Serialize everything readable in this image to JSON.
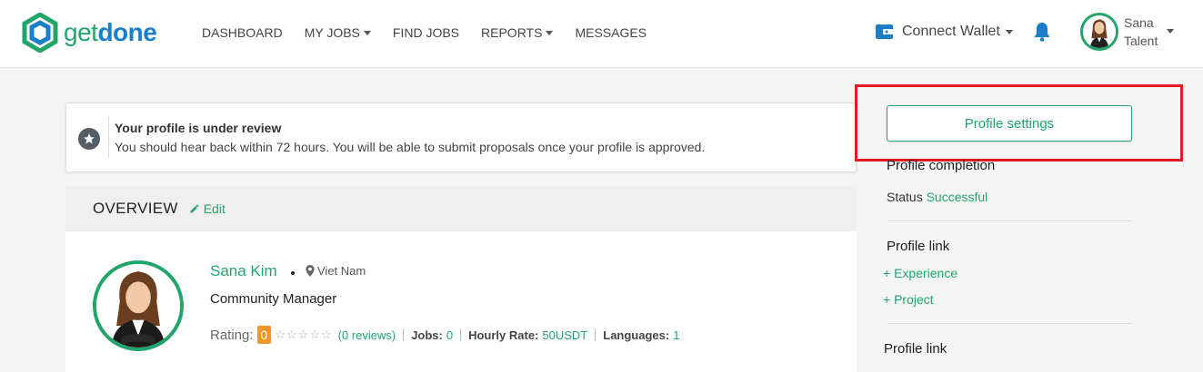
{
  "header": {
    "logo": {
      "part1": "get",
      "part2": "done"
    },
    "nav": [
      {
        "label": "DASHBOARD",
        "has_dropdown": false
      },
      {
        "label": "MY JOBS",
        "has_dropdown": true
      },
      {
        "label": "FIND JOBS",
        "has_dropdown": false
      },
      {
        "label": "REPORTS",
        "has_dropdown": true
      },
      {
        "label": "MESSAGES",
        "has_dropdown": false
      }
    ],
    "wallet_label": "Connect Wallet",
    "user": {
      "first": "Sana",
      "role": "Talent"
    }
  },
  "notice": {
    "title": "Your profile is under review",
    "body": "You should hear back within 72 hours. You will be able to submit proposals once your profile is approved.",
    "icon": "star-icon"
  },
  "overview": {
    "title": "OVERVIEW",
    "edit_label": "Edit",
    "profile": {
      "name": "Sana Kim",
      "location": "Viet Nam",
      "job_title": "Community Manager",
      "rating_label": "Rating:",
      "rating_value": "0",
      "stars": "☆☆☆☆☆",
      "reviews": "(0 reviews)",
      "jobs_label": "Jobs:",
      "jobs_value": "0",
      "rate_label": "Hourly Rate:",
      "rate_value": "50USDT",
      "languages_label": "Languages:",
      "languages_value": "1"
    }
  },
  "sidebar": {
    "settings_button": "Profile settings",
    "completion_title": "Profile completion",
    "status_label": "Status",
    "status_value": "Successful",
    "link_title_1": "Profile link",
    "add_experience": "+ Experience",
    "add_project": "+ Project",
    "link_title_2": "Profile link"
  },
  "colors": {
    "accent": "#21a56a",
    "brand_blue": "#1a7fc8",
    "highlight": "#e01b24",
    "rating_badge": "#f0962a"
  }
}
